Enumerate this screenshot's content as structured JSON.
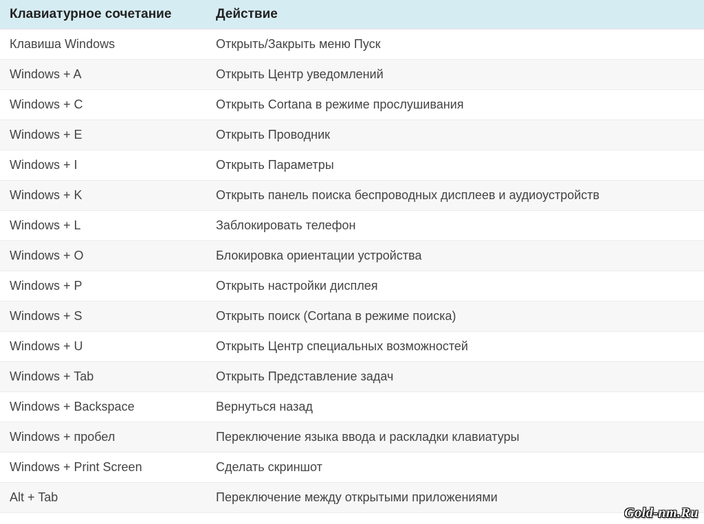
{
  "table": {
    "headers": {
      "shortcut": "Клавиатурное сочетание",
      "action": "Действие"
    },
    "rows": [
      {
        "shortcut": "Клавиша Windows",
        "action": "Открыть/Закрыть меню Пуск"
      },
      {
        "shortcut": "Windows + A",
        "action": "Открыть Центр уведомлений"
      },
      {
        "shortcut": "Windows + C",
        "action": "Открыть Cortana в режиме прослушивания"
      },
      {
        "shortcut": "Windows + E",
        "action": "Открыть Проводник"
      },
      {
        "shortcut": "Windows + I",
        "action": "Открыть Параметры"
      },
      {
        "shortcut": "Windows + K",
        "action": "Открыть панель поиска беспроводных дисплеев и аудиоустройств"
      },
      {
        "shortcut": "Windows + L",
        "action": "Заблокировать телефон"
      },
      {
        "shortcut": "Windows + O",
        "action": "Блокировка ориентации устройства"
      },
      {
        "shortcut": "Windows + P",
        "action": "Открыть настройки дисплея"
      },
      {
        "shortcut": "Windows + S",
        "action": "Открыть поиск (Cortana в режиме поиска)"
      },
      {
        "shortcut": "Windows + U",
        "action": "Открыть Центр специальных возможностей"
      },
      {
        "shortcut": "Windows + Tab",
        "action": "Открыть Представление задач"
      },
      {
        "shortcut": "Windows + Backspace",
        "action": "Вернуться назад"
      },
      {
        "shortcut": "Windows + пробел",
        "action": "Переключение языка ввода и раскладки клавиатуры"
      },
      {
        "shortcut": "Windows + Print Screen",
        "action": "Сделать скриншот"
      },
      {
        "shortcut": "Alt + Tab",
        "action": "Переключение между открытыми приложениями"
      }
    ]
  },
  "watermark": "Gold-nm.Ru"
}
